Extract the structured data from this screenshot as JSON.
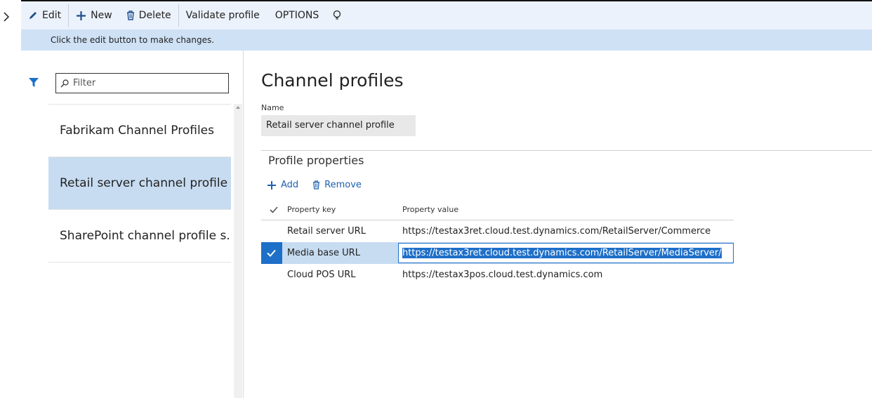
{
  "toolbar": {
    "edit_label": "Edit",
    "new_label": "New",
    "delete_label": "Delete",
    "validate_label": "Validate profile",
    "options_label": "OPTIONS"
  },
  "message_bar": {
    "text": "Click the edit button to make changes."
  },
  "filter": {
    "placeholder": "Filter"
  },
  "list": {
    "items": [
      {
        "label": "Fabrikam Channel Profiles",
        "selected": false
      },
      {
        "label": "Retail server channel profile",
        "selected": true
      },
      {
        "label": "SharePoint channel profile s...",
        "selected": false
      }
    ]
  },
  "detail": {
    "title": "Channel profiles",
    "name_label": "Name",
    "name_value": "Retail server channel profile",
    "section_title": "Profile properties",
    "add_label": "Add",
    "remove_label": "Remove",
    "grid": {
      "header_key": "Property key",
      "header_value": "Property value",
      "rows": [
        {
          "key": "Retail server URL",
          "value": "https://testax3ret.cloud.test.dynamics.com/RetailServer/Commerce",
          "selected": false
        },
        {
          "key": "Media base URL",
          "value": "https://testax3ret.cloud.test.dynamics.com/RetailServer/MediaServer/",
          "selected": true
        },
        {
          "key": "Cloud POS URL",
          "value": "https://testax3pos.cloud.test.dynamics.com",
          "selected": false
        }
      ]
    }
  },
  "colors": {
    "accent": "#1e6fc8",
    "toolbar_bg": "#ecf2fb",
    "selection_bg": "#c7dcf1",
    "message_bg": "#cfe1f5"
  }
}
